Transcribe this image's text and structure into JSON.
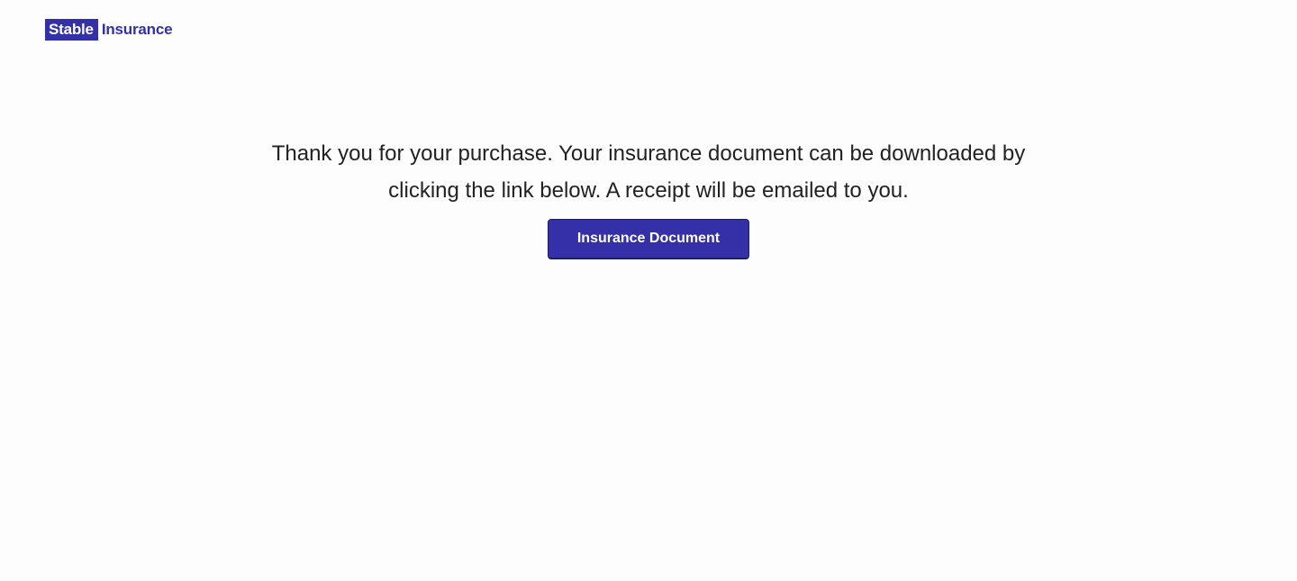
{
  "brand": {
    "box_text": "Stable",
    "text": "Insurance",
    "color": "#3330a8"
  },
  "main": {
    "message": "Thank you for your purchase. Your insurance document can be downloaded by clicking the link below. A receipt will be emailed to you.",
    "button_label": "Insurance Document"
  }
}
